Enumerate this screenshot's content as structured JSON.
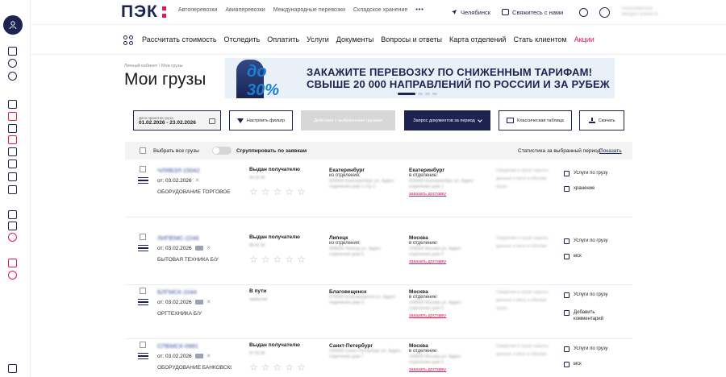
{
  "header": {
    "logo": "ПЭК",
    "top_nav": [
      "Автоперевозки",
      "Авиаперевозки",
      "Международные перевозки",
      "Складское хранение"
    ],
    "more": "•••",
    "city": "Челябинск",
    "contact": "Свяжитесь с нами",
    "user_line1": "Пользователь",
    "user_line2": "аккаунт клиента"
  },
  "main_nav": [
    "Рассчитать стоимость",
    "Отследить",
    "Оплатить",
    "Услуги",
    "Документы",
    "Вопросы и ответы",
    "Карта отделений",
    "Стать клиентом",
    "Акции"
  ],
  "breadcrumb": [
    "Личный кабинет",
    "Мои грузы"
  ],
  "breadcrumb_sep": "\\",
  "page_title": "Мои грузы",
  "banner": {
    "badge": "до 30%",
    "line1": "ЗАКАЖИТЕ ПЕРЕВОЗКУ ПО СНИЖЕННЫМ ТАРИФАМ!",
    "line2": "СВЫШЕ 20 000 НАПРАВЛЕНИЙ ПО РОССИИ И ЗА РУБЕЖ"
  },
  "filters": {
    "date_label": "Дата принятия груза",
    "date_value": "01.02.2026 - 23.02.2026",
    "filter_button": "Настроить фильтр",
    "actions_button": "Действия с выбранными грузами",
    "request_button": "Запрос документов за период",
    "classic_button": "Классическая таблица",
    "download_button": "Скачать"
  },
  "select_bar": {
    "select_all": "Выбрать все грузы",
    "group": "Сгруппировать по заявкам",
    "stats": "Статистика за выбранный период:",
    "show": "Показать"
  },
  "rows": [
    {
      "number": "ЧЛЯБЗЛ-15042",
      "date": "от: 03.02.2026",
      "cargo": "ОБОРУДОВАНИЕ ТОРГОВОЕ",
      "status": "Выдан получателю",
      "status_sub": "04.02.26",
      "from_city": "Екатеринбург",
      "from_sub": "из отделения:",
      "from_blur": "620000 Екатеринбург ул. Адрес отделения дом 1 стр 2",
      "to_city": "Екатеринбург",
      "to_sub": "в отделение:",
      "to_blur": "620000 Екатеринбург ул. Адрес отделения дом 1",
      "to_link": "заказать доставку",
      "info": "Сведения о грузе скрыты данные о весе и объеме груза",
      "act1": "Услуги по грузу",
      "act2": "хранение"
    },
    {
      "number": "ЛИПЕМС-2246",
      "date": "от: 03.02.2026",
      "cargo": "БЫТОВАЯ ТЕХНИКА Б/У",
      "status": "Выдан получателю",
      "status_sub": "06.02.26",
      "from_city": "Липецк",
      "from_sub": "из отделения:",
      "from_blur": "398000 Липецк ул. Адрес отделения дом 5",
      "to_city": "Москва",
      "to_sub": "в отделение:",
      "to_blur": "109000 Москва ул. Адрес отделения дом 2",
      "to_link": "заказать доставку",
      "info": "Сведения о грузе скрыты данные о весе и объеме",
      "act1": "Услуги по грузу",
      "act2": "мск"
    },
    {
      "number": "БЛГМСК-1044",
      "date": "от: 03.02.2026",
      "cargo": "ОРГТЕХНИКА Б/У",
      "status": "В пути",
      "status_sub": "прибытие",
      "from_city": "Благовещенск",
      "from_sub": "",
      "from_blur": "675000 Благовещенск ул. Адрес отделения дом 3",
      "to_city": "Москва",
      "to_sub": "в отделение:",
      "to_blur": "109000 Москва ул. Адрес отделения дом 2",
      "to_link": "заказать доставку",
      "info": "Сведения о грузе скрыты данные о весе и объеме груза",
      "act1": "Услуги по грузу",
      "act2": "Добавить комментарий"
    },
    {
      "number": "СПБМСК-0981",
      "date": "от: 03.02.2026",
      "cargo": "ОБОРУДОВАНИЕ БАНКОВСКОЕ",
      "status": "Выдан получателю",
      "status_sub": "07.02.26",
      "from_city": "Санкт-Петербург",
      "from_sub": "",
      "from_blur": "190000 Санкт-Петербург ул. Адрес отделения дом 7",
      "to_city": "Москва",
      "to_sub": "в отделение:",
      "to_blur": "109000 Москва ул. Адрес отделения дом 2",
      "to_link": "заказать доставку",
      "info": "Сведения о грузе скрыты данные о весе и объеме",
      "act1": "Услуги по грузу",
      "act2": "мск"
    }
  ],
  "colors": {
    "brand": "#1c2351",
    "accent": "#e4174e"
  }
}
